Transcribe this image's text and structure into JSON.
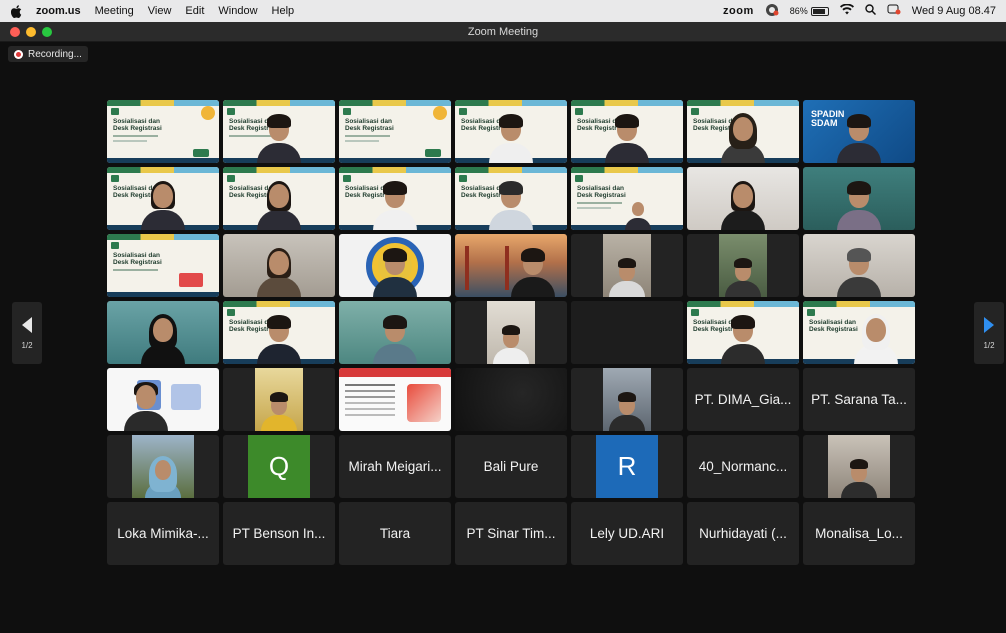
{
  "menubar": {
    "app": "zoom.us",
    "items": [
      "Meeting",
      "View",
      "Edit",
      "Window",
      "Help"
    ],
    "brand": "zoom",
    "battery": "86%",
    "datetime": "Wed 9 Aug  08.47"
  },
  "window": {
    "title": "Zoom Meeting"
  },
  "recording": {
    "label": "Recording..."
  },
  "slide": {
    "heading": "Sosialisasi dan\nDesk Registrasi"
  },
  "blue_banner": {
    "text": "SPADIN\nSDAM"
  },
  "pager": {
    "left_label": "1/2",
    "right_label": "1/2"
  },
  "tiles": {
    "r5c6": "PT. DIMA_Gia...",
    "r5c7": "PT. Sarana Ta...",
    "r6c2": "Q",
    "r6c3": "Mirah Meigari...",
    "r6c4": "Bali Pure",
    "r6c5": "R",
    "r6c6": "40_Normanc...",
    "r7c1": "Loka Mimika-...",
    "r7c2": "PT Benson In...",
    "r7c3": "Tiara",
    "r7c4": "PT Sinar Tim...",
    "r7c5": "Lely UD.ARI",
    "r7c6": "Nurhidayati (...",
    "r7c7": "Monalisa_Lo..."
  },
  "colors": {
    "active_speaker": "#3ac24a",
    "page_arrow": "#2f8ff0",
    "green_avatar": "#3d8a2a",
    "blue_avatar": "#1d6ab8"
  }
}
